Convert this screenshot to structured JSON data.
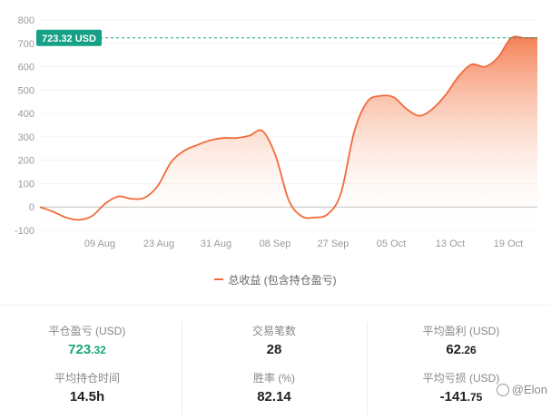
{
  "chart_data": {
    "type": "area",
    "ylim": [
      -100,
      800
    ],
    "yticks": [
      800,
      700,
      600,
      500,
      400,
      300,
      200,
      100,
      0,
      -100
    ],
    "x_labels": [
      "09 Aug",
      "23 Aug",
      "31 Aug",
      "08 Sep",
      "27 Sep",
      "05 Oct",
      "13 Oct",
      "19 Oct"
    ],
    "series": [
      {
        "name": "总收益 (包含持仓盈亏)",
        "color": "#f06b3c",
        "values": [
          0,
          -20,
          -45,
          -55,
          -38,
          15,
          45,
          35,
          40,
          90,
          190,
          240,
          265,
          285,
          295,
          295,
          305,
          325,
          220,
          30,
          -40,
          -45,
          -30,
          60,
          320,
          450,
          475,
          470,
          420,
          390,
          420,
          480,
          560,
          610,
          600,
          640,
          723,
          723,
          723
        ]
      }
    ],
    "current_value_label": "723.32 USD",
    "current_value": 723.32,
    "marker_color": "#16a085"
  },
  "legend": {
    "label": "总收益 (包含持仓盈亏)"
  },
  "stats": {
    "closed_pnl": {
      "label": "平仓盈亏 (USD)",
      "int": "723",
      "dec": ".32"
    },
    "avg_hold": {
      "label": "平均持仓时间",
      "value": "14.5h"
    },
    "trades": {
      "label": "交易笔数",
      "value": "28"
    },
    "win_rate": {
      "label": "胜率 (%)",
      "value": "82.14"
    },
    "avg_profit": {
      "label": "平均盈利 (USD)",
      "int": "62",
      "dec": ".26"
    },
    "avg_loss": {
      "label": "平均亏损 (USD)",
      "int": "-141",
      "dec": ".75"
    }
  },
  "watermark": {
    "text": "@Elon"
  }
}
